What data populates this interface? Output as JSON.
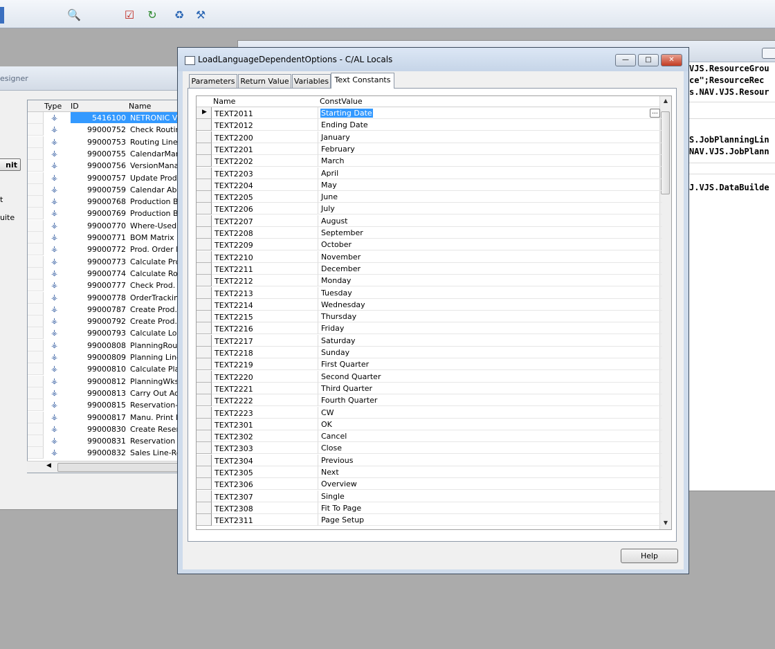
{
  "toolbar": {
    "icons": [
      "search-icon",
      "checklist-icon",
      "refresh-icon",
      "compile-icon",
      "debug-icon"
    ]
  },
  "designer": {
    "title_fragment": "esigner",
    "button_fragment": "nit",
    "left_text_1": "t",
    "left_text_2": "uite",
    "columns": {
      "type": "Type",
      "id": "ID",
      "name": "Name"
    },
    "rows": [
      {
        "id": "5416100",
        "name": "NETRONIC VJ"
      },
      {
        "id": "99000752",
        "name": "Check Routing"
      },
      {
        "id": "99000753",
        "name": "Routing Line-C"
      },
      {
        "id": "99000755",
        "name": "CalendarMana"
      },
      {
        "id": "99000756",
        "name": "VersionManag"
      },
      {
        "id": "99000757",
        "name": "Update Prod."
      },
      {
        "id": "99000759",
        "name": "Calendar Abse"
      },
      {
        "id": "99000768",
        "name": "Production BC"
      },
      {
        "id": "99000769",
        "name": "Production BC"
      },
      {
        "id": "99000770",
        "name": "Where-Used M"
      },
      {
        "id": "99000771",
        "name": "BOM Matrix M"
      },
      {
        "id": "99000772",
        "name": "Prod. Order R"
      },
      {
        "id": "99000773",
        "name": "Calculate Prod"
      },
      {
        "id": "99000774",
        "name": "Calculate Rou"
      },
      {
        "id": "99000777",
        "name": "Check Prod. O"
      },
      {
        "id": "99000778",
        "name": "OrderTracking"
      },
      {
        "id": "99000787",
        "name": "Create Prod."
      },
      {
        "id": "99000792",
        "name": "Create Prod."
      },
      {
        "id": "99000793",
        "name": "Calculate Low"
      },
      {
        "id": "99000808",
        "name": "PlanningRouti"
      },
      {
        "id": "99000809",
        "name": "Planning Line"
      },
      {
        "id": "99000810",
        "name": "Calculate Plan"
      },
      {
        "id": "99000812",
        "name": "PlanningWksh"
      },
      {
        "id": "99000813",
        "name": "Carry Out Act"
      },
      {
        "id": "99000815",
        "name": "Reservation-C"
      },
      {
        "id": "99000817",
        "name": "Manu. Print R"
      },
      {
        "id": "99000830",
        "name": "Create Reserv"
      },
      {
        "id": "99000831",
        "name": "Reservation E"
      },
      {
        "id": "99000832",
        "name": "Sales Line-Res"
      }
    ]
  },
  "code_window": {
    "lines": [
      "VJS.ResourceGrou",
      "ce\";ResourceRec",
      "s.NAV.VJS.Resour",
      "S.JobPlanningLin",
      "NAV.VJS.JobPlann",
      "J.VJS.DataBuilde"
    ]
  },
  "dialog": {
    "title": "LoadLanguageDependentOptions - C/AL Locals",
    "tabs": [
      "Parameters",
      "Return Value",
      "Variables",
      "Text Constants"
    ],
    "active_tab": "Text Constants",
    "columns": {
      "name": "Name",
      "value": "ConstValue"
    },
    "rows": [
      {
        "name": "TEXT2011",
        "value": "Starting Date"
      },
      {
        "name": "TEXT2012",
        "value": "Ending Date"
      },
      {
        "name": "TEXT2200",
        "value": "January"
      },
      {
        "name": "TEXT2201",
        "value": "February"
      },
      {
        "name": "TEXT2202",
        "value": "March"
      },
      {
        "name": "TEXT2203",
        "value": "April"
      },
      {
        "name": "TEXT2204",
        "value": "May"
      },
      {
        "name": "TEXT2205",
        "value": "June"
      },
      {
        "name": "TEXT2206",
        "value": "July"
      },
      {
        "name": "TEXT2207",
        "value": "August"
      },
      {
        "name": "TEXT2208",
        "value": "September"
      },
      {
        "name": "TEXT2209",
        "value": "October"
      },
      {
        "name": "TEXT2210",
        "value": "November"
      },
      {
        "name": "TEXT2211",
        "value": "December"
      },
      {
        "name": "TEXT2212",
        "value": "Monday"
      },
      {
        "name": "TEXT2213",
        "value": "Tuesday"
      },
      {
        "name": "TEXT2214",
        "value": "Wednesday"
      },
      {
        "name": "TEXT2215",
        "value": "Thursday"
      },
      {
        "name": "TEXT2216",
        "value": "Friday"
      },
      {
        "name": "TEXT2217",
        "value": "Saturday"
      },
      {
        "name": "TEXT2218",
        "value": "Sunday"
      },
      {
        "name": "TEXT2219",
        "value": "First Quarter"
      },
      {
        "name": "TEXT2220",
        "value": "Second Quarter"
      },
      {
        "name": "TEXT2221",
        "value": "Third Quarter"
      },
      {
        "name": "TEXT2222",
        "value": "Fourth Quarter"
      },
      {
        "name": "TEXT2223",
        "value": "CW"
      },
      {
        "name": "TEXT2301",
        "value": "OK"
      },
      {
        "name": "TEXT2302",
        "value": "Cancel"
      },
      {
        "name": "TEXT2303",
        "value": "Close"
      },
      {
        "name": "TEXT2304",
        "value": "Previous"
      },
      {
        "name": "TEXT2305",
        "value": "Next"
      },
      {
        "name": "TEXT2306",
        "value": "Overview"
      },
      {
        "name": "TEXT2307",
        "value": "Single"
      },
      {
        "name": "TEXT2308",
        "value": "Fit To Page"
      },
      {
        "name": "TEXT2311",
        "value": "Page Setup"
      }
    ],
    "ellipsis_label": "...",
    "help_label": "Help"
  }
}
